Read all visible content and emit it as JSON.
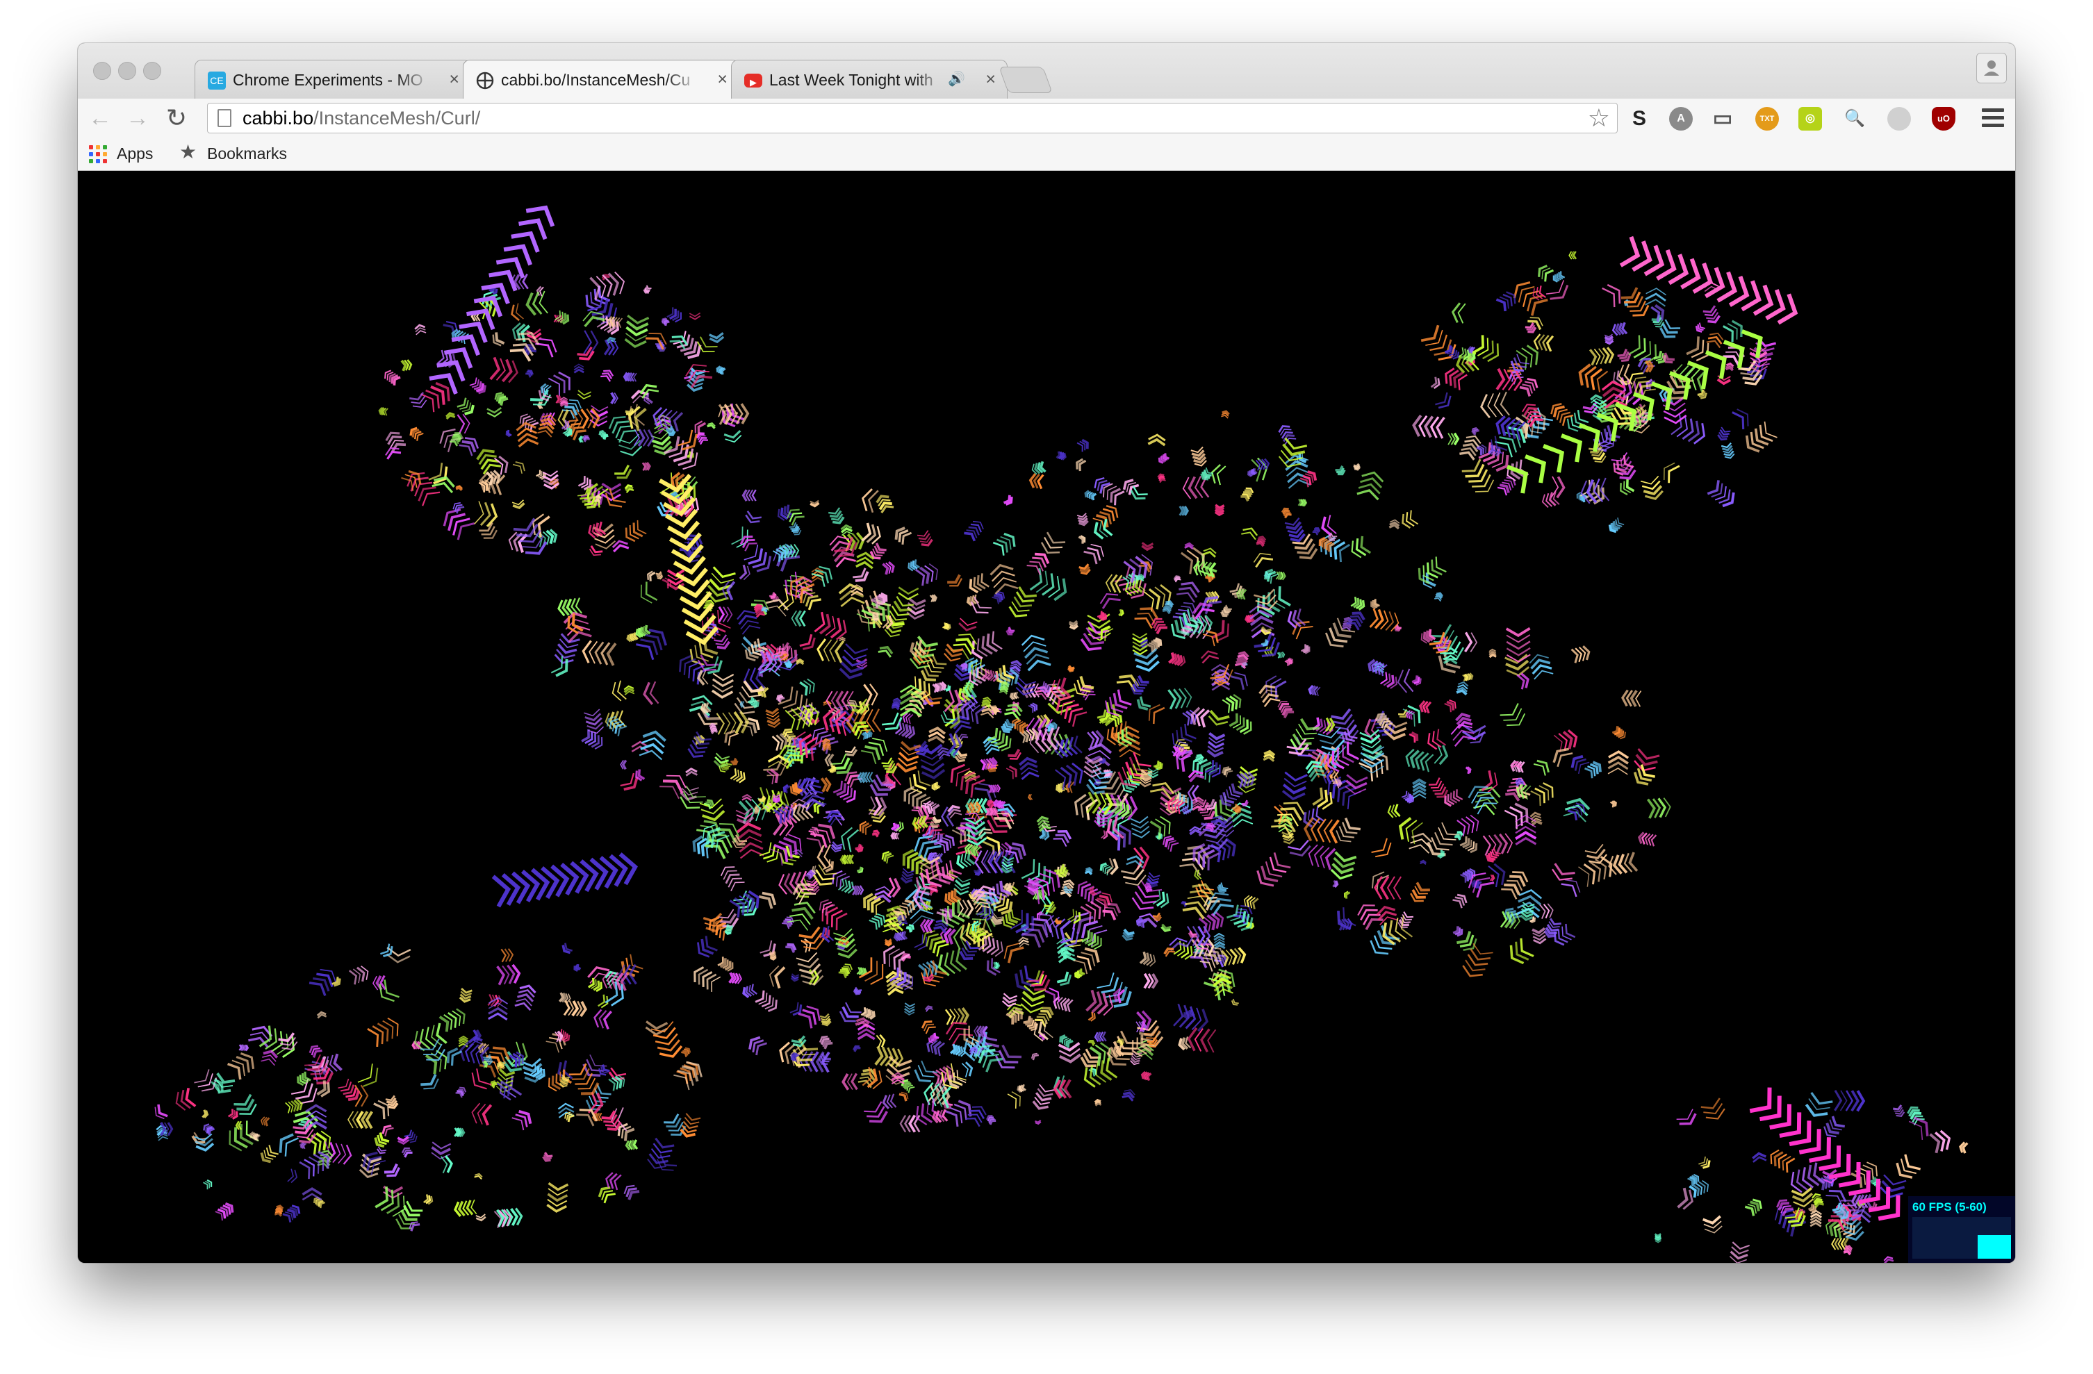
{
  "browser": {
    "tabs": [
      {
        "title": "Chrome Experiments - MO",
        "favicon_text": "CE",
        "favicon_color": "#27a9e1",
        "active": false
      },
      {
        "title": "cabbi.bo/InstanceMesh/Cu",
        "favicon_text": "",
        "favicon_color": "#5a5a5a",
        "active": true
      },
      {
        "title": "Last Week Tonight with",
        "favicon_text": "▶",
        "favicon_color": "#e52d27",
        "active": false,
        "audio": true
      }
    ],
    "close_glyph": "×",
    "audio_glyph": "🔊",
    "nav": {
      "back": "←",
      "forward": "→",
      "reload": "↻"
    },
    "address": {
      "host": "cabbi.bo",
      "path": "/InstanceMesh/Curl/"
    },
    "star_glyph": "☆",
    "extensions": [
      {
        "name": "s-extension-icon",
        "glyph": "S",
        "color": "#2b2b2b"
      },
      {
        "name": "angular-extension-icon",
        "glyph": "A",
        "color": "#7a7a7a"
      },
      {
        "name": "cast-icon",
        "glyph": "▭",
        "color": "#6a6a6a"
      },
      {
        "name": "txt-extension-icon",
        "glyph": "TXT",
        "color": "#e49b1a"
      },
      {
        "name": "green-extension-icon",
        "glyph": "◎",
        "color": "#b5d318"
      },
      {
        "name": "magnifier-extension-icon",
        "glyph": "🔍",
        "color": "#8aa8c8"
      },
      {
        "name": "grey-circle-extension-icon",
        "glyph": "",
        "color": "#c8c8c8"
      },
      {
        "name": "ublock-icon",
        "glyph": "uO",
        "color": "#a00000"
      }
    ],
    "bookmarks": [
      {
        "label": "Apps",
        "icon": "apps-grid-icon"
      },
      {
        "label": "Bookmarks",
        "icon": "star-icon",
        "glyph": "★"
      }
    ]
  },
  "stats_panel": {
    "label": "60 FPS (5-60)",
    "fps": 60,
    "min": 5,
    "max": 60
  },
  "colors": {
    "palette": [
      "#ff66cc",
      "#ffd9b3",
      "#e84dff",
      "#ffee66",
      "#b266ff",
      "#66ffcc",
      "#ff3385",
      "#8a5cff",
      "#ffcc99",
      "#99ff66",
      "#66ccff",
      "#ff8c33",
      "#ffaaee",
      "#ccff33",
      "#4d33cc"
    ]
  }
}
